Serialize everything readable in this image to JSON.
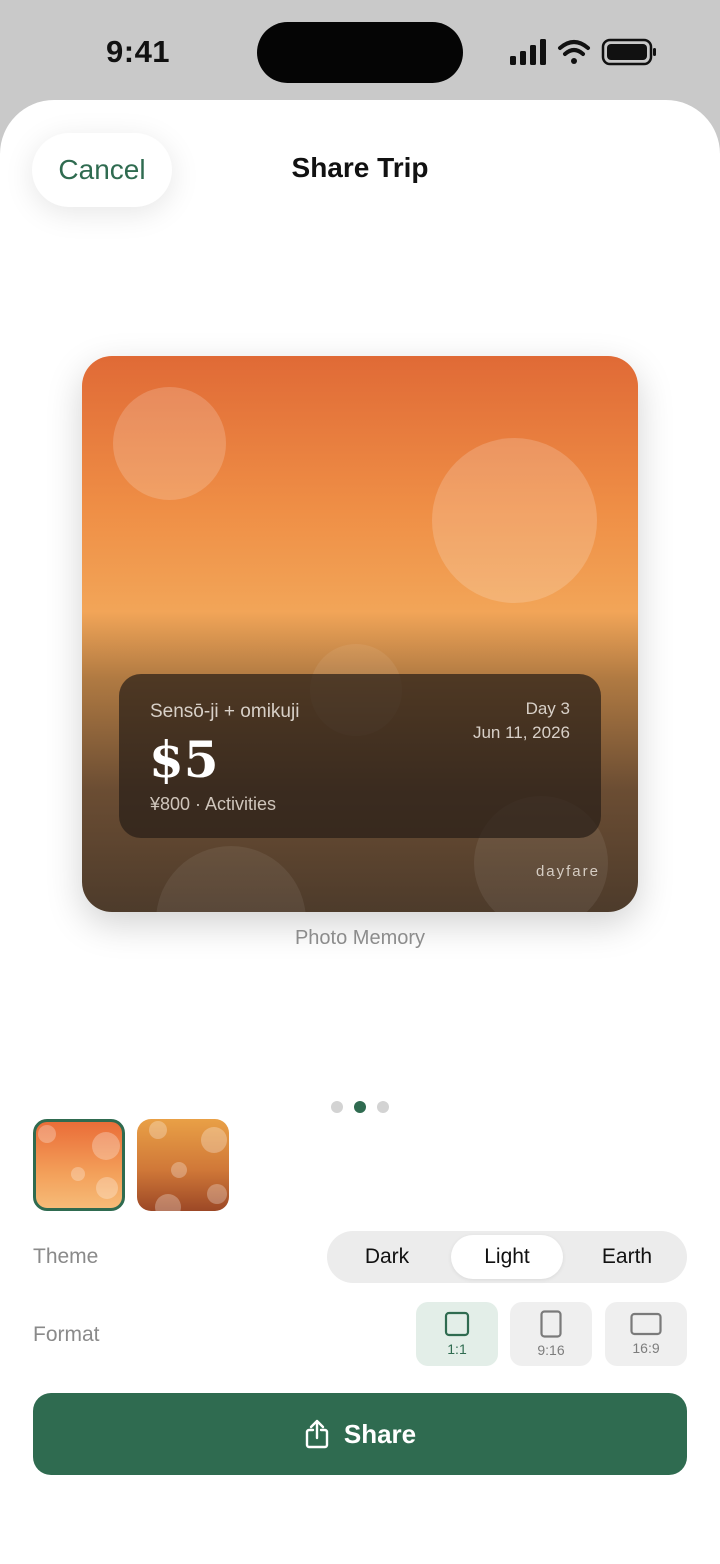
{
  "status_bar": {
    "time": "9:41",
    "icons": [
      "signal-icon",
      "wifi-icon",
      "battery-icon"
    ]
  },
  "header": {
    "cancel_label": "Cancel",
    "title": "Share Trip"
  },
  "card": {
    "place": "Sensō-ji + omikuji",
    "amount": "$5",
    "sub": "¥800 · Activities",
    "day": "Day 3",
    "date": "Jun 11, 2026",
    "brand": "dayfare",
    "caption": "Photo Memory"
  },
  "pager": {
    "count": 3,
    "active_index": 1
  },
  "thumbnails": [
    {
      "name": "thumbnail-sunset",
      "selected": true
    },
    {
      "name": "thumbnail-amber",
      "selected": false
    }
  ],
  "theme": {
    "label": "Theme",
    "options": [
      "Dark",
      "Light",
      "Earth"
    ],
    "selected": "Light"
  },
  "format": {
    "label": "Format",
    "options": [
      "1:1",
      "9:16",
      "16:9"
    ],
    "selected": "1:1"
  },
  "share_label": "Share",
  "colors": {
    "accent": "#2f6b50",
    "sheet_bg": "#ffffff",
    "backdrop": "#c9c9c9"
  }
}
